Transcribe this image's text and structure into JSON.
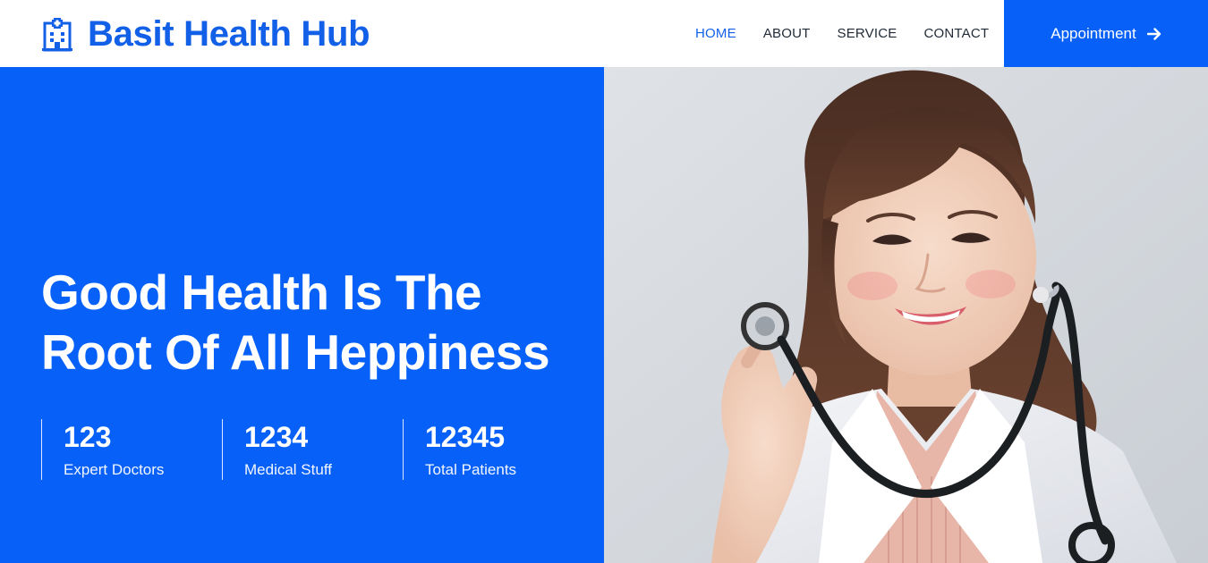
{
  "brand": {
    "name": "Basit Health Hub",
    "icon": "hospital-icon",
    "color": "#1360e8"
  },
  "nav": {
    "items": [
      {
        "label": "HOME",
        "active": true
      },
      {
        "label": "ABOUT",
        "active": false
      },
      {
        "label": "SERVICE",
        "active": false
      },
      {
        "label": "CONTACT",
        "active": false
      }
    ],
    "cta": {
      "label": "Appointment",
      "icon": "arrow-right-icon"
    }
  },
  "hero": {
    "title_line1": "Good Health Is The",
    "title_line2": "Root Of All Heppiness",
    "background": "#0761f8",
    "stats": [
      {
        "value": "123",
        "label": "Expert Doctors"
      },
      {
        "value": "1234",
        "label": "Medical Stuff"
      },
      {
        "value": "12345",
        "label": "Total Patients"
      }
    ],
    "image": "doctor-photo"
  }
}
